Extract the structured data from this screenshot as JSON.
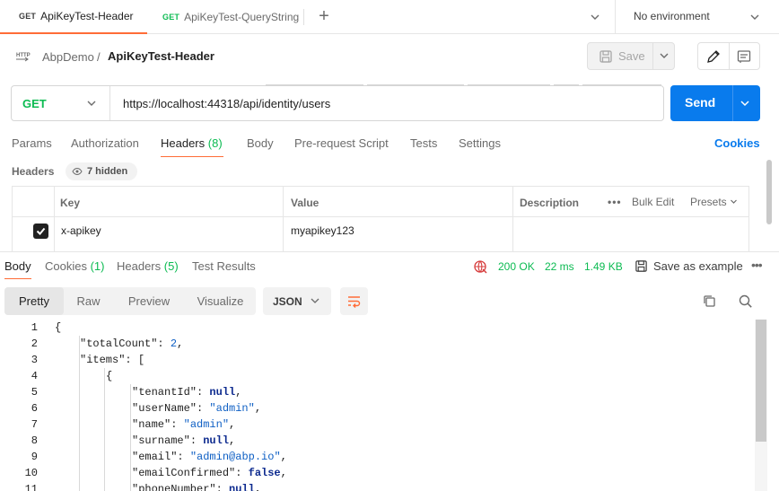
{
  "tabs": [
    {
      "method": "GET",
      "label": "ApiKeyTest-Header"
    },
    {
      "method": "GET",
      "label": "ApiKeyTest-QueryString"
    }
  ],
  "environment": "No environment",
  "breadcrumb": {
    "parent": "AbpDemo",
    "separator": "/",
    "current": "ApiKeyTest-Header"
  },
  "toolbar": {
    "save_label": "Save"
  },
  "request": {
    "method": "GET",
    "url": "https://localhost:44318/api/identity/users",
    "send_label": "Send"
  },
  "request_tabs": [
    {
      "label": "Params"
    },
    {
      "label": "Authorization"
    },
    {
      "label": "Headers",
      "count": "(8)"
    },
    {
      "label": "Body"
    },
    {
      "label": "Pre-request Script"
    },
    {
      "label": "Tests"
    },
    {
      "label": "Settings"
    }
  ],
  "cookies_link": "Cookies",
  "headers_section": {
    "title": "Headers",
    "hidden_label": "7 hidden",
    "columns": {
      "key": "Key",
      "value": "Value",
      "description": "Description"
    },
    "bulk_edit": "Bulk Edit",
    "presets": "Presets",
    "rows": [
      {
        "key": "x-apikey",
        "value": "myapikey123",
        "description": "",
        "checked": true
      }
    ]
  },
  "response_tabs": [
    {
      "label": "Body"
    },
    {
      "label": "Cookies",
      "count": "(1)"
    },
    {
      "label": "Headers",
      "count": "(5)"
    },
    {
      "label": "Test Results"
    }
  ],
  "response_meta": {
    "status": "200 OK",
    "time": "22 ms",
    "size": "1.49 KB",
    "save_example": "Save as example"
  },
  "view_modes": [
    "Pretty",
    "Raw",
    "Preview",
    "Visualize"
  ],
  "format": "JSON",
  "code_lines": [
    {
      "n": "1",
      "t": "{"
    },
    {
      "n": "2",
      "t": "\"totalCount\": 2,"
    },
    {
      "n": "3",
      "t": "\"items\": ["
    },
    {
      "n": "4",
      "t": "{"
    },
    {
      "n": "5",
      "t": "\"tenantId\": null,"
    },
    {
      "n": "6",
      "t": "\"userName\": \"admin\","
    },
    {
      "n": "7",
      "t": "\"name\": \"admin\","
    },
    {
      "n": "8",
      "t": "\"surname\": null,"
    },
    {
      "n": "9",
      "t": "\"email\": \"admin@abp.io\","
    },
    {
      "n": "10",
      "t": "\"emailConfirmed\": false,"
    },
    {
      "n": "11",
      "t": "\"phoneNumber\": null,"
    }
  ],
  "colors": {
    "accent": "#ff6c37",
    "primary": "#097bed",
    "success": "#0cbb52"
  },
  "icons": [
    "http-icon",
    "save-icon",
    "edit-icon",
    "documentation-icon",
    "eye-icon",
    "checkbox-icon",
    "globe-icon",
    "copy-icon",
    "search-icon",
    "wrap-icon",
    "more-icon",
    "plus-icon",
    "chevron-down-icon"
  ]
}
